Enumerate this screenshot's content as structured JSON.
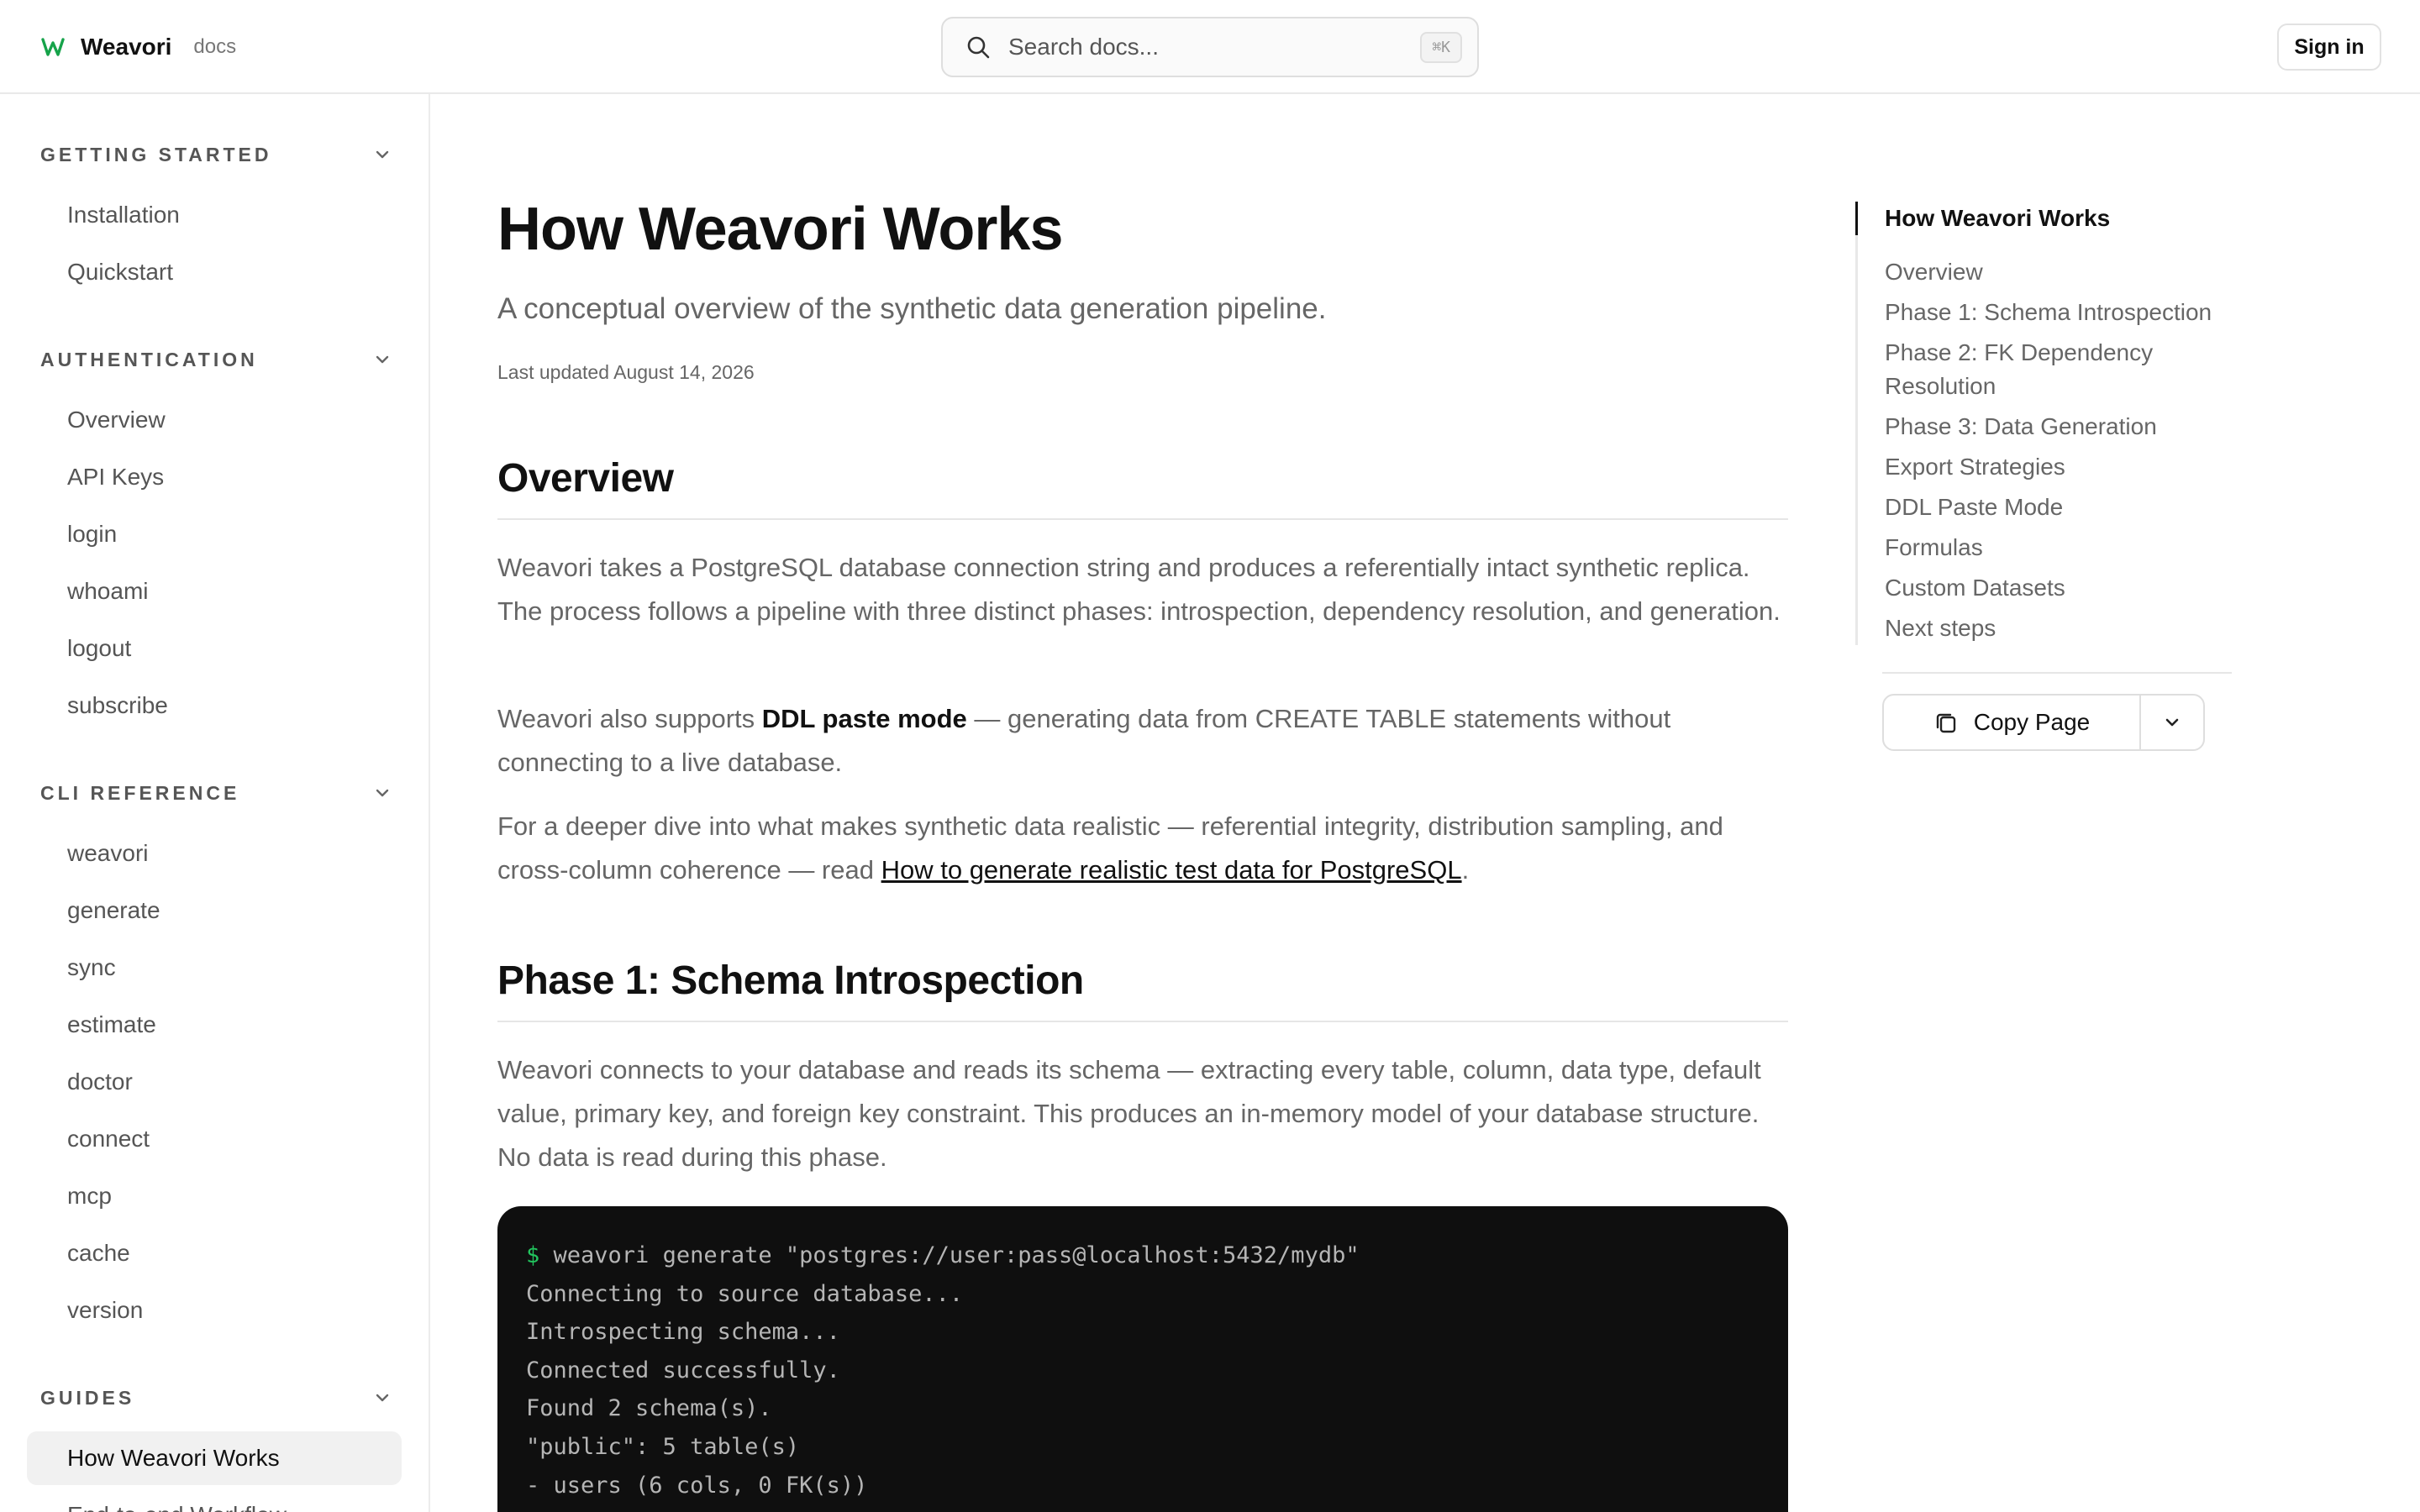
{
  "header": {
    "brand_name": "Weavori",
    "brand_tag": "docs",
    "search_placeholder": "Search docs...",
    "search_shortcut": "⌘K",
    "signin_label": "Sign in"
  },
  "sidebar": {
    "sections": [
      {
        "title": "GETTING STARTED",
        "items": [
          "Installation",
          "Quickstart"
        ]
      },
      {
        "title": "AUTHENTICATION",
        "items": [
          "Overview",
          "API Keys",
          "login",
          "whoami",
          "logout",
          "subscribe"
        ]
      },
      {
        "title": "CLI REFERENCE",
        "items": [
          "weavori",
          "generate",
          "sync",
          "estimate",
          "doctor",
          "connect",
          "mcp",
          "cache",
          "version"
        ]
      },
      {
        "title": "GUIDES",
        "items": [
          "How Weavori Works",
          "End-to-end Workflow"
        ]
      }
    ],
    "active_item": "How Weavori Works"
  },
  "main": {
    "title": "How Weavori Works",
    "subtitle": "A conceptual overview of the synthetic data generation pipeline.",
    "last_updated": "Last updated August 14, 2026",
    "overview_heading": "Overview",
    "overview_p1": "Weavori takes a PostgreSQL database connection string and produces a referentially intact synthetic replica. The process follows a pipeline with three distinct phases: introspection, dependency resolution, and generation.",
    "overview_p2_pre": "Weavori also supports ",
    "overview_p2_bold": "DDL paste mode",
    "overview_p2_post": " — generating data from CREATE TABLE statements without connecting to a live database.",
    "overview_p3_pre": "For a deeper dive into what makes synthetic data realistic — referential integrity, distribution sampling, and cross-column coherence — read ",
    "overview_p3_link": "How to generate realistic test data for PostgreSQL",
    "overview_p3_post": ".",
    "phase1_heading": "Phase 1: Schema Introspection",
    "phase1_p1": "Weavori connects to your database and reads its schema — extracting every table, column, data type, default value, primary key, and foreign key constraint. This produces an in-memory model of your database structure. No data is read during this phase.",
    "code": {
      "prompt": "$",
      "command": " weavori generate \"postgres://user:pass@localhost:5432/mydb\"",
      "lines": [
        "Connecting to source database...",
        "Introspecting schema...",
        "Connected successfully.",
        "Found 2 schema(s).",
        "\"public\": 5 table(s)",
        "- users (6 cols, 0 FK(s))"
      ]
    }
  },
  "toc": {
    "items": [
      "How Weavori Works",
      "Overview",
      "Phase 1: Schema Introspection",
      "Phase 2: FK Dependency Resolution",
      "Phase 3: Data Generation",
      "Export Strategies",
      "DDL Paste Mode",
      "Formulas",
      "Custom Datasets",
      "Next steps"
    ],
    "copy_label": "Copy Page"
  },
  "colors": {
    "brand": "#16a34a",
    "prompt": "#22c55e",
    "code_bg": "#0f0f0f"
  }
}
